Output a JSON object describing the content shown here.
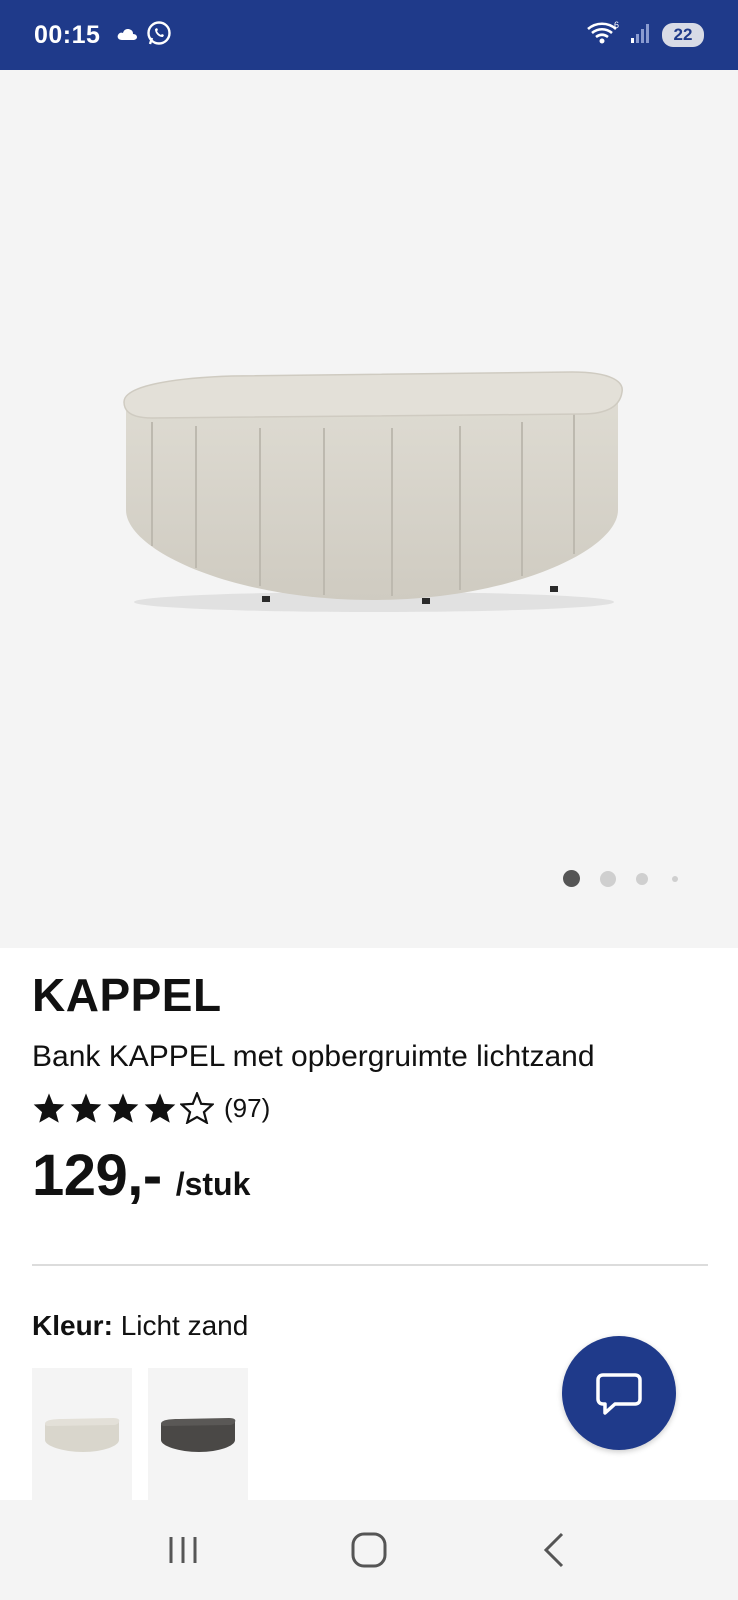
{
  "status_bar": {
    "time": "00:15",
    "battery": "22",
    "icons": [
      "cloud-icon",
      "whatsapp-icon",
      "wifi-icon",
      "signal-icon"
    ]
  },
  "carousel": {
    "image_alt": "Bank KAPPEL met opbergruimte lichtzand",
    "current_index": 1,
    "total": 4
  },
  "product": {
    "brand": "KAPPEL",
    "description": "Bank KAPPEL met opbergruimte lichtzand",
    "rating": 4.5,
    "rating_count": "(97)",
    "price": "129,-",
    "unit": "/stuk"
  },
  "color": {
    "label": "Kleur:",
    "value": "Licht zand",
    "swatches": [
      {
        "name": "Licht zand",
        "selected": true,
        "color": "#d9d6cc"
      },
      {
        "name": "Donkergrijs",
        "selected": false,
        "color": "#4a4846"
      }
    ]
  },
  "colors": {
    "brand_blue": "#1f3a8a",
    "text": "#111111"
  },
  "navigation": {
    "buttons": [
      "recent-apps-icon",
      "home-icon",
      "back-icon"
    ]
  }
}
